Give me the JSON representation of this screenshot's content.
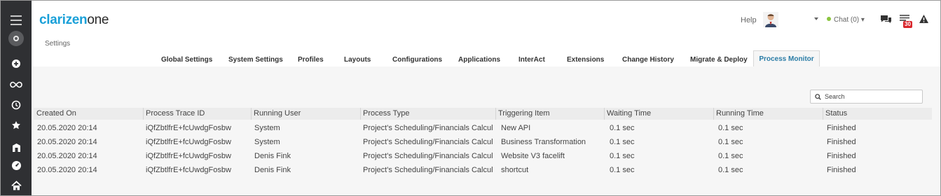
{
  "header": {
    "logo_part1": "clarizen",
    "logo_part2": "one",
    "help_label": "Help",
    "chat_label": "Chat (0) ▾",
    "notification_count": "30",
    "status_color": "#8bc53f",
    "brand_color": "#1aa0d8"
  },
  "breadcrumb": {
    "title": "Settings"
  },
  "tabs": [
    {
      "label": "Global Settings"
    },
    {
      "label": "System Settings"
    },
    {
      "label": "Profiles"
    },
    {
      "label": "Layouts"
    },
    {
      "label": "Configurations"
    },
    {
      "label": "Applications"
    },
    {
      "label": "InterAct"
    },
    {
      "label": "Extensions"
    },
    {
      "label": "Change History"
    },
    {
      "label": "Migrate & Deploy"
    },
    {
      "label": "Process Monitor",
      "active": true
    }
  ],
  "search": {
    "placeholder": "Search"
  },
  "table": {
    "columns": [
      "Created On",
      "Process Trace ID",
      "Running User",
      "Process Type",
      "Triggering Item",
      "Waiting Time",
      "Running Time",
      "Status"
    ],
    "rows": [
      [
        "20.05.2020 20:14",
        "iQfZbtlfrE+fcUwdgFosbw",
        "System",
        "Project's Scheduling/Financials Calculati...",
        "New API",
        "0.1 sec",
        "0.1 sec",
        "Finished"
      ],
      [
        "20.05.2020 20:14",
        "iQfZbtlfrE+fcUwdgFosbw",
        "System",
        "Project's Scheduling/Financials Calculati...",
        "Business Transformation",
        "0.1 sec",
        "0.1 sec",
        "Finished"
      ],
      [
        "20.05.2020 20:14",
        "iQfZbtlfrE+fcUwdgFosbw",
        "Denis Fink",
        "Project's Scheduling/Financials Calculati...",
        "Website V3 facelift",
        "0.1 sec",
        "0.1 sec",
        "Finished"
      ],
      [
        "20.05.2020 20:14",
        "iQfZbtlfrE+fcUwdgFosbw",
        "Denis Fink",
        "Project's Scheduling/Financials Calculati...",
        "shortcut",
        "0.1 sec",
        "0.1 sec",
        "Finished"
      ]
    ]
  },
  "rail_icons": [
    "menu-icon",
    "search-icon",
    "plus-icon",
    "infinity-icon",
    "history-icon",
    "star-icon",
    "building-icon",
    "dashboard-icon",
    "home-icon"
  ]
}
